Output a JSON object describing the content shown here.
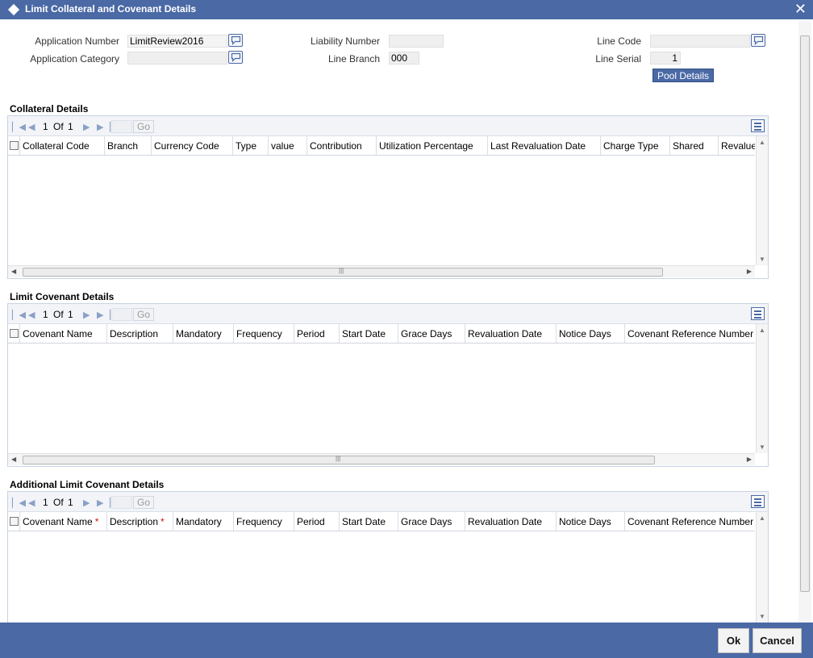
{
  "window": {
    "title": "Limit Collateral and Covenant Details",
    "close_glyph": "✕"
  },
  "form": {
    "application_number_label": "Application Number",
    "application_number_value": "LimitReview2016",
    "application_category_label": "Application Category",
    "application_category_value": "",
    "liability_number_label": "Liability Number",
    "liability_number_value": "",
    "line_branch_label": "Line Branch",
    "line_branch_value": "000",
    "line_code_label": "Line Code",
    "line_code_value": "",
    "line_serial_label": "Line Serial",
    "line_serial_value": "1",
    "pool_details_label": "Pool Details"
  },
  "collateral": {
    "title": "Collateral Details",
    "page": "1",
    "of": "Of",
    "total": "1",
    "go": "Go",
    "columns": [
      "Collateral Code",
      "Branch",
      "Currency Code",
      "Type",
      "value",
      "Contribution",
      "Utilization Percentage",
      "Last Revaluation Date",
      "Charge Type",
      "Shared",
      "Revalue"
    ]
  },
  "covenant": {
    "title": "Limit Covenant Details",
    "page": "1",
    "of": "Of",
    "total": "1",
    "go": "Go",
    "columns": [
      "Covenant Name",
      "Description",
      "Mandatory",
      "Frequency",
      "Period",
      "Start Date",
      "Grace Days",
      "Revaluation Date",
      "Notice Days",
      "Covenant Reference Number"
    ]
  },
  "additional": {
    "title": "Additional Limit Covenant Details",
    "page": "1",
    "of": "Of",
    "total": "1",
    "go": "Go",
    "columns": [
      "Covenant Name",
      "Description",
      "Mandatory",
      "Frequency",
      "Period",
      "Start Date",
      "Grace Days",
      "Revaluation Date",
      "Notice Days",
      "Covenant Reference Number"
    ],
    "required_mark": "*"
  },
  "footer": {
    "ok_label": "Ok",
    "cancel_label": "Cancel"
  },
  "colors": {
    "brand": "#4a69a5",
    "required": "#d01010"
  },
  "icons": [
    "diamond-icon",
    "close-icon",
    "lov-icon",
    "first-page-icon",
    "prev-page-icon",
    "next-page-icon",
    "last-page-icon",
    "column-menu-icon"
  ]
}
